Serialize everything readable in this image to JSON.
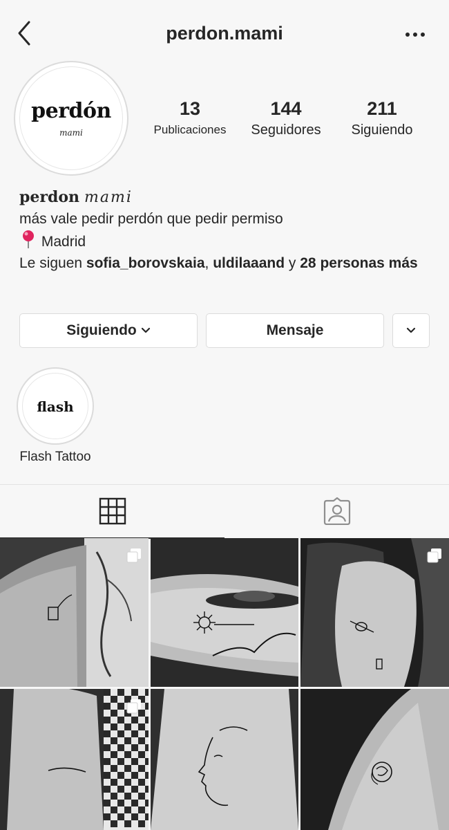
{
  "header": {
    "username": "perdon.mami"
  },
  "profile": {
    "avatar_wordmark": "perdón",
    "avatar_subtext": "mami",
    "stats": [
      {
        "value": "13",
        "label": "Publicaciones"
      },
      {
        "value": "144",
        "label": "Seguidores"
      },
      {
        "value": "211",
        "label": "Siguiendo"
      }
    ],
    "display_name_bold": "perdon",
    "display_name_italic": "mami",
    "bio_line": "más vale pedir perdón que pedir permiso",
    "location": "Madrid",
    "followed_prefix": "Le siguen",
    "followed_user1": "sofia_borovskaia",
    "followed_sep": ",",
    "followed_user2": "uldilaaand",
    "followed_and": "y",
    "followed_rest": "28 personas más"
  },
  "actions": {
    "following_label": "Siguiendo",
    "message_label": "Mensaje"
  },
  "highlights": [
    {
      "wordmark": "flash",
      "label": "Flash Tattoo"
    }
  ],
  "tabs": [
    {
      "icon": "grid-icon",
      "active": true
    },
    {
      "icon": "tagged-icon",
      "active": false
    }
  ],
  "posts": [
    {
      "subject": "tattoo-plant-pot-arm",
      "multi": true
    },
    {
      "subject": "tattoo-flower-ufo-arm",
      "multi": false
    },
    {
      "subject": "tattoo-avocado-arm",
      "multi": true
    },
    {
      "subject": "tattoo-line-arm",
      "multi": true
    },
    {
      "subject": "tattoo-face-profile-arm",
      "multi": false
    },
    {
      "subject": "tattoo-rose-arm",
      "multi": false
    }
  ],
  "colors": {
    "text": "#262626",
    "border": "#dbdbdb",
    "background": "#f7f7f7",
    "pin": "#e0245e"
  }
}
